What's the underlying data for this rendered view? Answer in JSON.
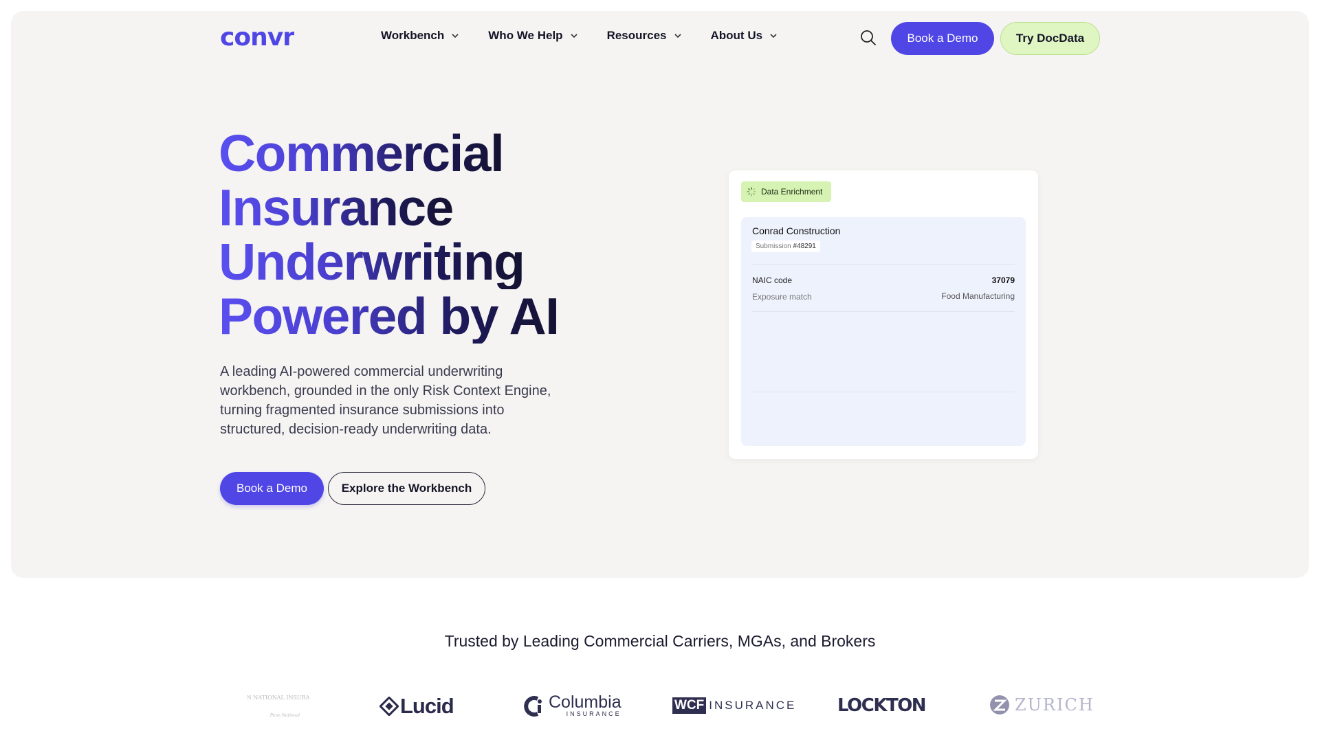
{
  "brand": {
    "name": "convr",
    "primary": "#5046e5",
    "accent_green": "#dff6c3"
  },
  "nav": {
    "items": [
      {
        "label": "Workbench"
      },
      {
        "label": "Who We Help"
      },
      {
        "label": "Resources"
      },
      {
        "label": "About Us"
      }
    ],
    "search_icon": "search-icon",
    "book_demo": "Book a Demo",
    "try_docdata": "Try DocData"
  },
  "hero": {
    "headline": [
      "Commercial",
      "Insurance",
      "Underwriting",
      "Powered by AI"
    ],
    "subtext": "A leading AI-powered commercial underwriting workbench, grounded in the only Risk Context Engine, turning fragmented insurance submissions into structured, decision-ready underwriting data.",
    "cta_primary": "Book a Demo",
    "cta_secondary": "Explore the Workbench"
  },
  "card": {
    "badge": "Data Enrichment",
    "company": "Conrad Construction",
    "submission_label": "Submission",
    "submission_number": "#48291",
    "rows": [
      {
        "label": "NAIC code",
        "value": "37079"
      },
      {
        "label": "Exposure match",
        "value": "Food Manufacturing"
      }
    ]
  },
  "trusted": {
    "heading": "Trusted by Leading Commercial Carriers, MGAs, and Brokers",
    "logos": [
      {
        "name": "PENN NATIONAL INSURANCE",
        "sub": "Penn National Insurance"
      },
      {
        "name": "Lucid"
      },
      {
        "name": "Columbia",
        "sub": "INSURANCE"
      },
      {
        "name": "WCF",
        "sub": "INSURANCE"
      },
      {
        "name": "LOCKTON"
      },
      {
        "name": "ZURICH"
      }
    ]
  }
}
